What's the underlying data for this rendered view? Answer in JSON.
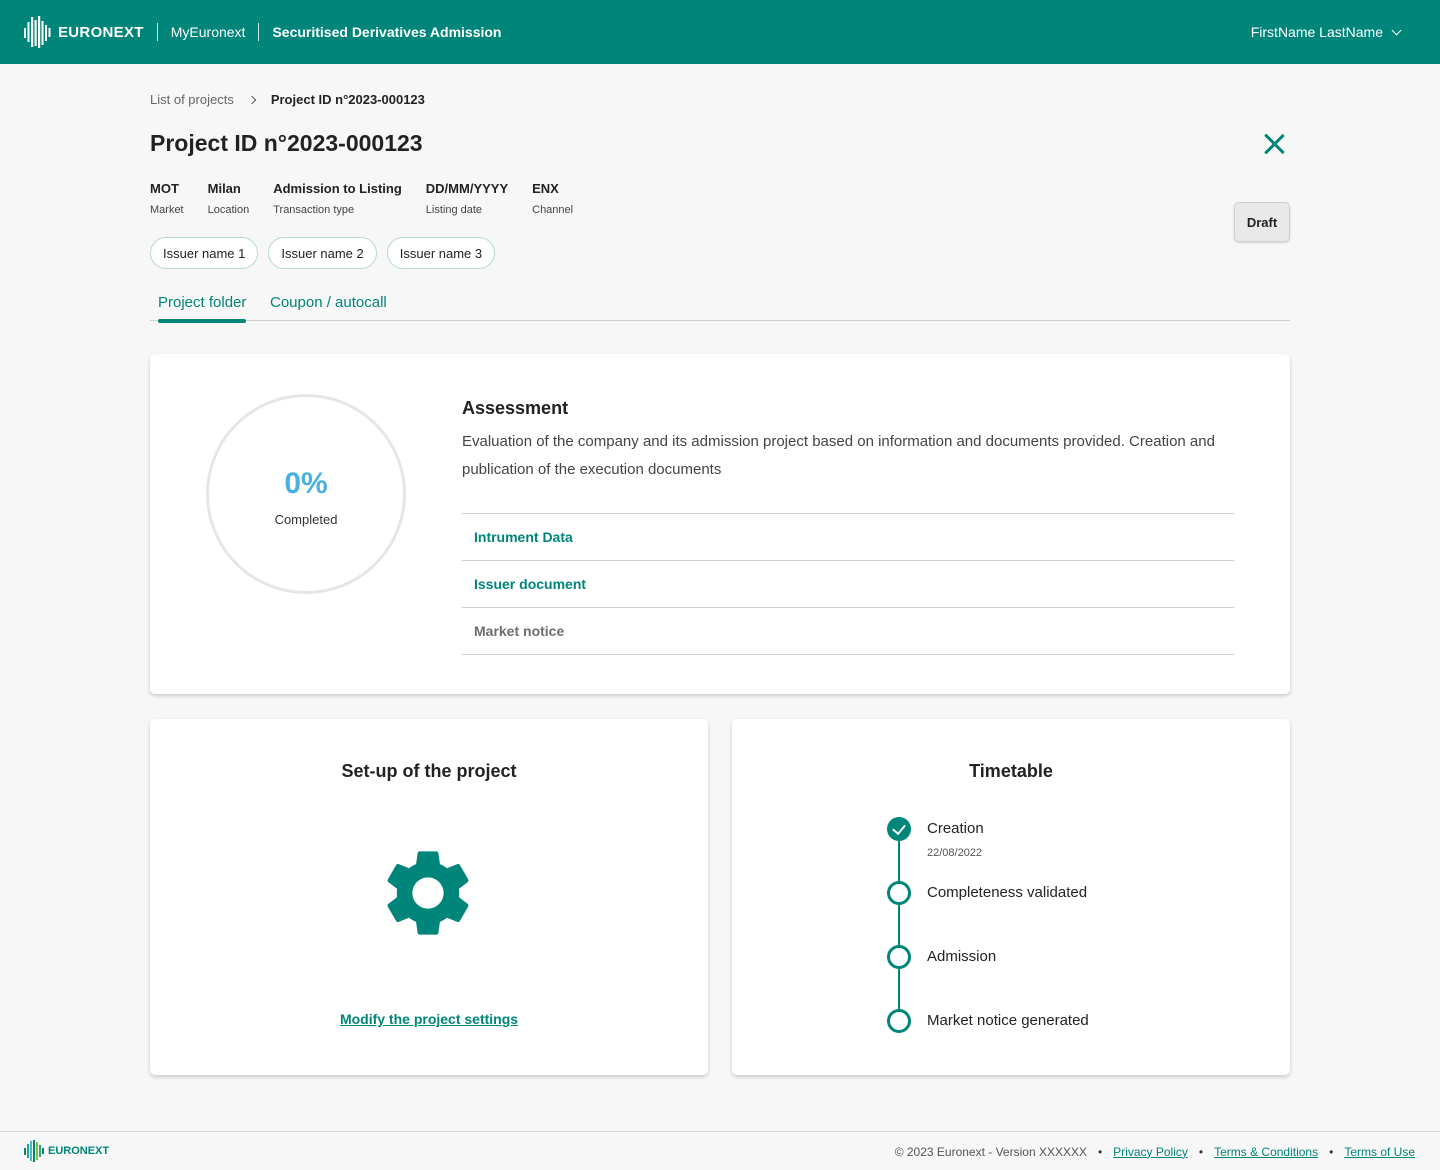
{
  "header": {
    "logo_text": "EURONEXT",
    "nav_link": "MyEuronext",
    "app_title": "Securitised Derivatives Admission",
    "user_name": "FirstName LastName"
  },
  "breadcrumb": {
    "parent": "List of projects",
    "current": "Project ID n°2023-000123"
  },
  "project": {
    "title": "Project ID n°2023-000123",
    "status": "Draft",
    "meta": [
      {
        "value": "MOT",
        "label": "Market"
      },
      {
        "value": "Milan",
        "label": "Location"
      },
      {
        "value": "Admission to Listing",
        "label": "Transaction type"
      },
      {
        "value": "DD/MM/YYYY",
        "label": "Listing date"
      },
      {
        "value": "ENX",
        "label": "Channel"
      }
    ],
    "issuers": [
      "Issuer name 1",
      "Issuer name 2",
      "Issuer name 3"
    ]
  },
  "tabs": [
    "Project folder",
    "Coupon / autocall"
  ],
  "assessment": {
    "percent_text": "0%",
    "percent_value": 0,
    "completed_label": "Completed",
    "title": "Assessment",
    "description": "Evaluation of the company and its admission project based on information and documents provided. Creation and publication of the execution documents",
    "items": [
      "Intrument Data",
      "Issuer document",
      "Market notice"
    ]
  },
  "setup": {
    "title": "Set-up of the project",
    "icon": "gear-icon",
    "link": "Modify the project settings"
  },
  "timetable": {
    "title": "Timetable",
    "steps": [
      {
        "label": "Creation",
        "date": "22/08/2022",
        "done": true
      },
      {
        "label": "Completeness validated",
        "done": false
      },
      {
        "label": "Admission",
        "done": false
      },
      {
        "label": "Market notice generated",
        "done": false
      }
    ]
  },
  "footer": {
    "logo_text": "EURONEXT",
    "copyright": "© 2023 Euronext - Version XXXXXX",
    "links": [
      "Privacy Policy",
      "Terms & Conditions",
      "Terms of Use"
    ]
  },
  "colors": {
    "brand": "#00857a",
    "percent": "#4ab0e0"
  }
}
